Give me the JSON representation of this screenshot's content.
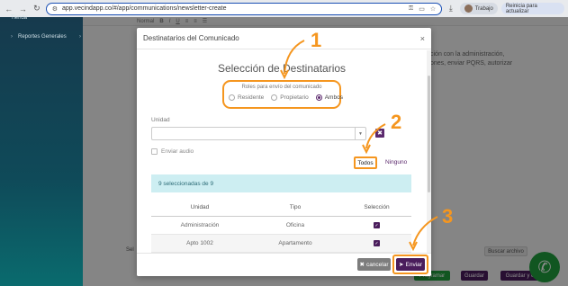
{
  "browser": {
    "url": "app.vecindapp.co/#/app/communications/newsletter-create",
    "profile_label": "Trabajo",
    "update_label": "Reinicia para actualizar"
  },
  "sidebar": {
    "items": [
      {
        "label": "Tienda"
      },
      {
        "label": "Reportes Generales"
      }
    ]
  },
  "background": {
    "toolbar_label": "Normal",
    "text_line1": "ción con la administración,",
    "text_line2": "ones, enviar PQRS, autorizar",
    "select_placeholder": "Sel",
    "buscar_label": "Buscar archivo",
    "programar_label": "Programar",
    "guardar_label": "Guardar",
    "guardar_enviar_label": "Guardar y enviar"
  },
  "modal": {
    "title": "Destinatarios del Comunicado",
    "close_symbol": "×",
    "section_title": "Selección de Destinatarios",
    "roles_caption": "Roles para envío del comunicado",
    "roles": [
      {
        "label": "Residente",
        "checked": false
      },
      {
        "label": "Propietario",
        "checked": false
      },
      {
        "label": "Ambos",
        "checked": true
      }
    ],
    "unidad_label": "Unidad",
    "unidad_value": "",
    "audio_label": "Enviar audio",
    "todos_label": "Todos",
    "ninguno_label": "Ninguno",
    "selected_text": "9 seleccionadas de 9",
    "table": {
      "headers": [
        "Unidad",
        "Tipo",
        "Selección"
      ],
      "rows": [
        {
          "unidad": "Administración",
          "tipo": "Oficina",
          "selected": true
        },
        {
          "unidad": "Apto 1002",
          "tipo": "Apartamento",
          "selected": true
        }
      ]
    },
    "cancel_label": "cancelar",
    "send_label": "Enviar"
  },
  "annotations": {
    "step1": "1",
    "step2": "2",
    "step3": "3",
    "color": "#f5961f"
  },
  "colors": {
    "primary": "#4a1d5c",
    "accent": "#f5961f",
    "alert_bg": "#cdeef2",
    "sidebar": "#163a4d"
  }
}
